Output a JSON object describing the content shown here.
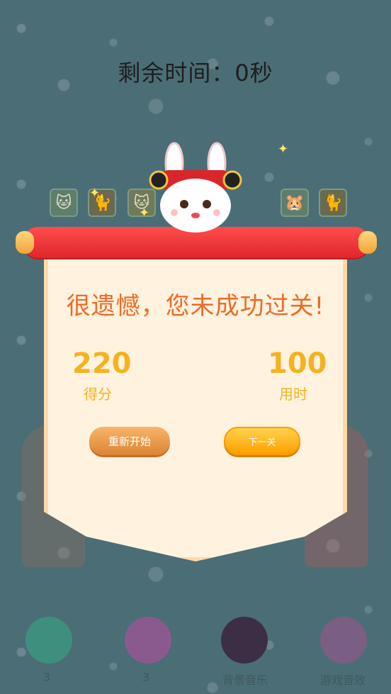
{
  "header": {
    "timer_text": "剩余时间：0秒"
  },
  "dialog": {
    "message": "很遗憾，您未成功过关!",
    "score": {
      "value": "220",
      "label": "得分"
    },
    "time_used": {
      "value": "100",
      "label": "用时"
    },
    "buttons": {
      "restart": "重新开始",
      "next": "下一关"
    }
  },
  "bottom_bar": {
    "count_1": "3",
    "count_2": "3",
    "background_music_label": "背景音乐",
    "game_sound_label": "游戏音效"
  },
  "colors": {
    "message": "#ee6a27",
    "stat": "#f5b21f",
    "scroll_red": "#e0262b",
    "panel": "#fff3df"
  },
  "icons": [
    "rabbit-mascot-icon",
    "cat-tile-icon",
    "lucky-cat-tile-icon",
    "hamster-tile-icon",
    "sparkle-icon"
  ]
}
